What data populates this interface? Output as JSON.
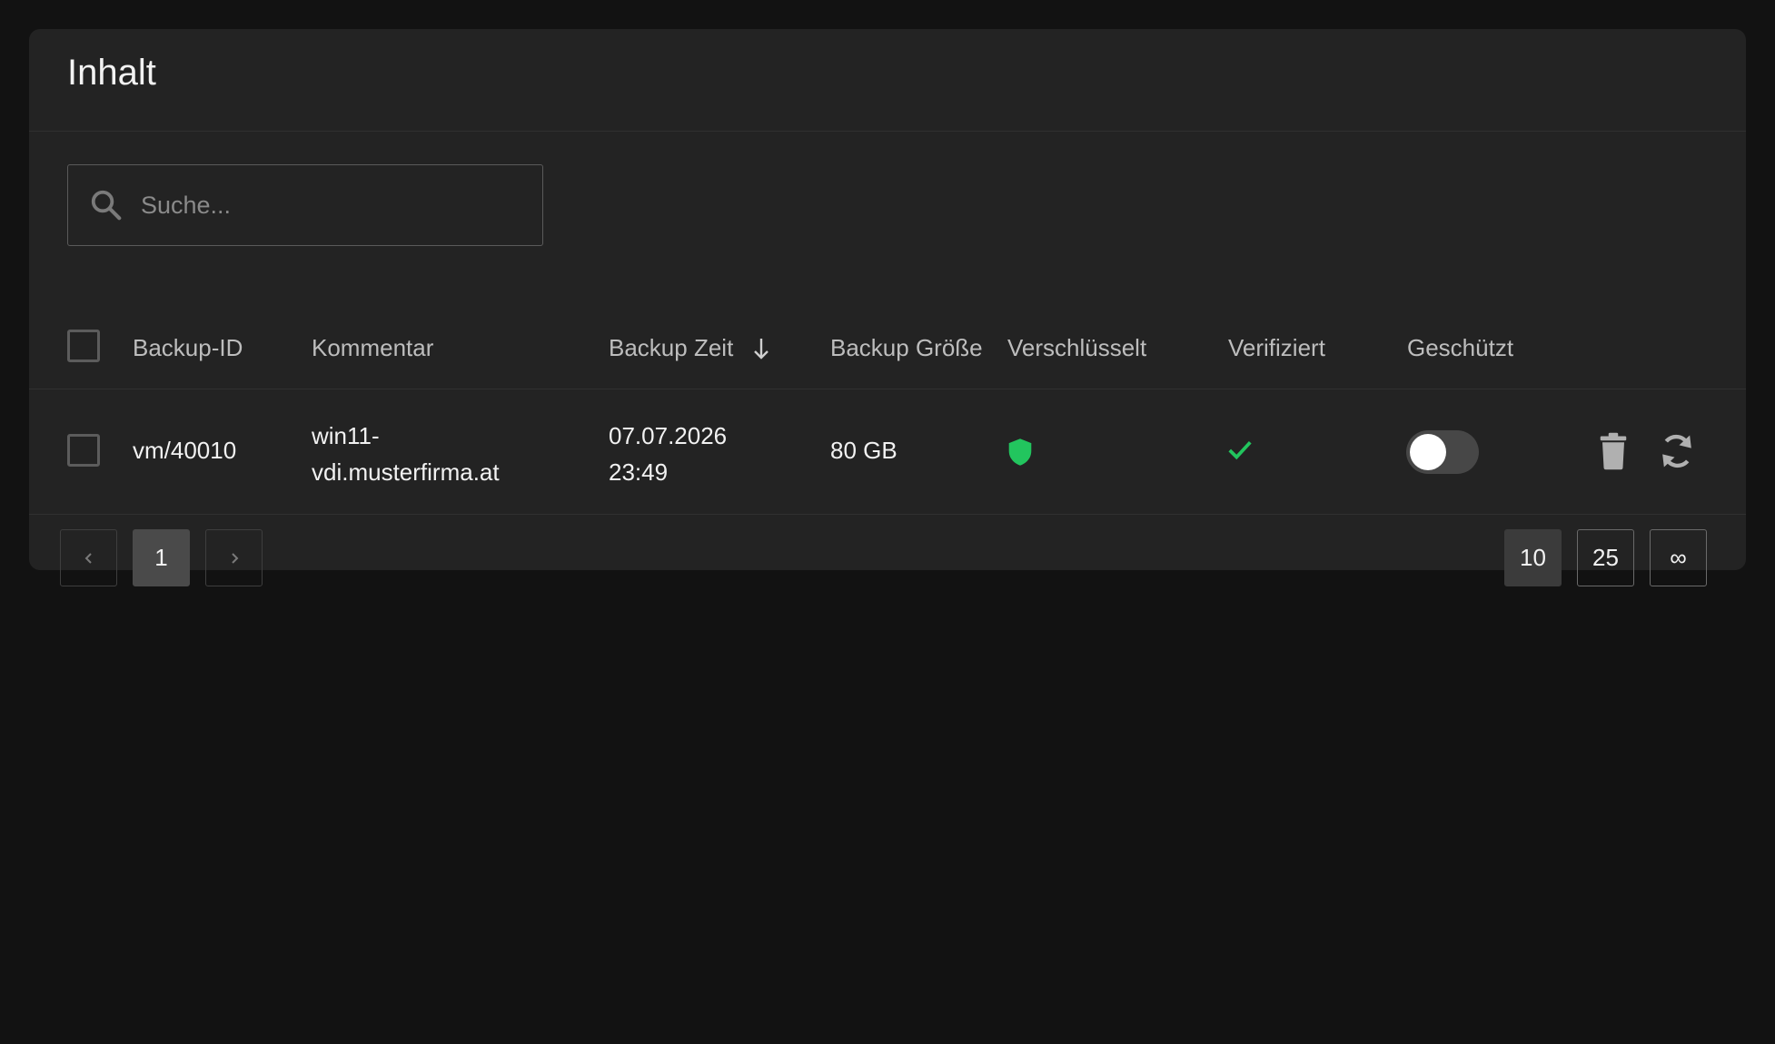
{
  "card": {
    "title": "Inhalt"
  },
  "search": {
    "placeholder": "Suche...",
    "value": ""
  },
  "table": {
    "columns": {
      "backup_id": "Backup-ID",
      "comment": "Kommentar",
      "backup_time": "Backup Zeit",
      "backup_size": "Backup Größe",
      "encrypted": "Verschlüsselt",
      "verified": "Verifiziert",
      "protected": "Geschützt"
    },
    "sort": {
      "column": "backup_time",
      "direction": "descending",
      "icon": "arrow-down-icon"
    },
    "rows": [
      {
        "backup_id": "vm/40010",
        "comment_line1": "win11-",
        "comment_line2": "vdi.musterfirma.at",
        "time_line1": "07.07.2026",
        "time_line2": "23:49",
        "size": "80 GB",
        "encrypted_icon": "shield-icon",
        "verified_icon": "checkmark-icon",
        "protected": false,
        "actions": [
          "trash-icon",
          "restore-icon"
        ]
      }
    ]
  },
  "pagination": {
    "prev_icon": "chevron-left-icon",
    "current_page": "1",
    "next_icon": "chevron-right-icon",
    "page_sizes": [
      "10",
      "25",
      "∞"
    ],
    "selected_page_size": "10"
  },
  "colors": {
    "background": "#121212",
    "card": "#232323",
    "success_green": "#22c55e",
    "icon_gray": "#b0b0b0"
  }
}
